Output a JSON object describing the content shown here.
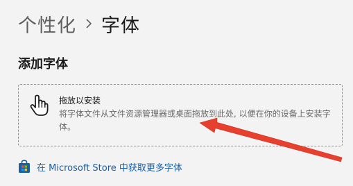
{
  "breadcrumb": {
    "parent": "个性化",
    "separator_icon": "chevron-right-icon",
    "current": "字体"
  },
  "section": {
    "title": "添加字体"
  },
  "drop_zone": {
    "icon": "hand-pointer-icon",
    "title": "拖放以安装",
    "description": "将字体文件从文件资源管理器或桌面拖放到此处, 以便在你的设备上安装字体。"
  },
  "store_link": {
    "icon": "microsoft-store-icon",
    "label": "在 Microsoft Store 中获取更多字体"
  },
  "colors": {
    "background": "#f3f3f3",
    "link": "#1a5fa5",
    "annotation_arrow": "#e8402f"
  }
}
